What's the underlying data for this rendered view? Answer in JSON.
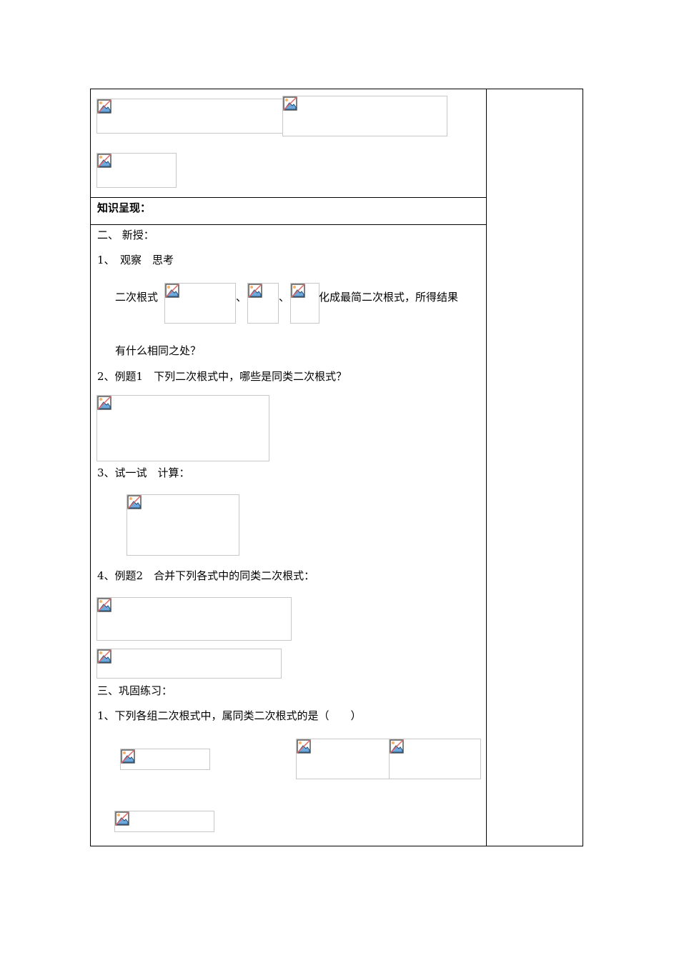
{
  "section_header": "知识呈现：",
  "new_lesson": {
    "title": "二、 新授：",
    "item1_title": "1、　观察　思考",
    "item1_lead": "二次根式",
    "separator1": "、",
    "separator2": "、",
    "item1_tail": "化成最简二次根式，所得结果",
    "item1_question": "有什么相同之处？",
    "item2": "2、例题1　下列二次根式中，哪些是同类二次根式？",
    "item3": "3、试一试　计算：",
    "item4": "4、例题2　合并下列各式中的同类二次根式："
  },
  "practice": {
    "title": "三、巩固练习：",
    "item1": "1、下列各组二次根式中，属同类二次根式的是（　　）"
  },
  "icons": {
    "placeholder": "broken-image-icon"
  }
}
